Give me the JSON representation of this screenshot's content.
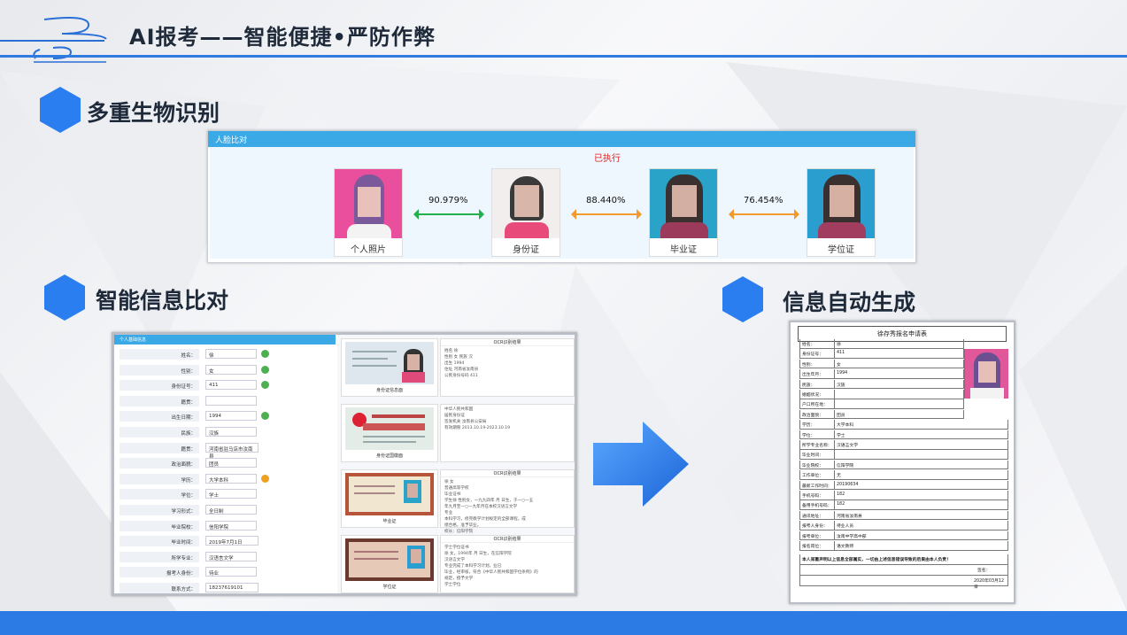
{
  "header": {
    "title": "AI报考——智能便捷•严防作弊"
  },
  "sections": {
    "bio": "多重生物识别",
    "info": "智能信息比对",
    "auto": "信息自动生成"
  },
  "face_compare": {
    "title": "人脸比对",
    "status": "已执行",
    "photos": [
      {
        "label": "个人照片"
      },
      {
        "label": "身份证"
      },
      {
        "label": "毕业证"
      },
      {
        "label": "学位证"
      }
    ],
    "scores": [
      "90.979%",
      "88.440%",
      "76.454%"
    ]
  },
  "info_compare": {
    "panel_title": "个人基础信息",
    "fields": [
      {
        "label": "姓名：",
        "value": "徐",
        "mark": "ok"
      },
      {
        "label": "性别：",
        "value": "女",
        "mark": "ok"
      },
      {
        "label": "身份证号：",
        "value": "411",
        "mark": "ok"
      },
      {
        "label": "籍贯：",
        "value": "",
        "mark": ""
      },
      {
        "label": "出生日期：",
        "value": "1994",
        "mark": "ok"
      },
      {
        "label": "民族：",
        "value": "汉族",
        "mark": ""
      },
      {
        "label": "籍贯：",
        "value": "河南省驻马店市汝南县",
        "mark": ""
      },
      {
        "label": "政治面貌：",
        "value": "团员",
        "mark": ""
      },
      {
        "label": "学历：",
        "value": "大学本科",
        "mark": "warn"
      },
      {
        "label": "学位：",
        "value": "学士",
        "mark": ""
      },
      {
        "label": "学习形式：",
        "value": "全日制",
        "mark": ""
      },
      {
        "label": "毕业院校：",
        "value": "信阳学院",
        "mark": ""
      },
      {
        "label": "毕业时间：",
        "value": "2019年7月1日",
        "mark": ""
      },
      {
        "label": "所学专业：",
        "value": "汉语言文学",
        "mark": ""
      },
      {
        "label": "报考人身份：",
        "value": "待业",
        "mark": ""
      },
      {
        "label": "联系方式：",
        "value": "18237619101",
        "mark": ""
      }
    ],
    "ocr_header": "OCR识别结果",
    "docs": [
      {
        "caption": "身份证信息面",
        "ocr": "姓名 徐\n性别 女 民族 汉\n出生 1994\n住址 河南省汝南县\n公民身份号码 411"
      },
      {
        "caption": "身份证国徽面",
        "ocr": "中华人民共和国\n居民身份证\n签发机关 汝南县公安局\n有效期限 2013.10.19-2023.10.19"
      },
      {
        "caption": "毕业证",
        "ocr": "徐 女\n普通高等学校\n毕业证书\n学生徐 性别女，一九九四年 月 日生，于一○一五\n年九月至一○一九年月在本校汉语言文学\n专业\n本科学习，修完教学计划规定的全部课程，成\n绩合格，准予毕业。\n校长：信阳学院"
      },
      {
        "caption": "学位证",
        "ocr": "学士学位证书\n徐 女，1994年 月 日生，在信阳学院\n汉语言文学\n专业完成了本科学习计划，业已\n毕业，经审核，符合《中华人民共和国学位条例》的\n规定，授予文学\n学士学位"
      }
    ]
  },
  "auto_form": {
    "title": "徐存秀报名申请表",
    "rows": [
      {
        "k": "姓名：",
        "v": "徐"
      },
      {
        "k": "身份证号：",
        "v": "411"
      },
      {
        "k": "性别：",
        "v": "女"
      },
      {
        "k": "出生年月：",
        "v": "1994"
      },
      {
        "k": "民族：",
        "v": "汉族"
      },
      {
        "k": "婚姻状况：",
        "v": ""
      },
      {
        "k": "户口所在地：",
        "v": ""
      },
      {
        "k": "政治面貌：",
        "v": "团员"
      },
      {
        "k": "学历：",
        "v": "大学本科"
      },
      {
        "k": "学位：",
        "v": "学士"
      },
      {
        "k": "所学专业名称：",
        "v": "汉语言文学"
      },
      {
        "k": "毕业时间：",
        "v": ""
      },
      {
        "k": "毕业院校：",
        "v": "信阳学院"
      },
      {
        "k": "工作单位：",
        "v": "无"
      },
      {
        "k": "最新工作时间：",
        "v": "20190634"
      },
      {
        "k": "手机号码：",
        "v": "182"
      },
      {
        "k": "备用手机号码：",
        "v": "182"
      },
      {
        "k": "通讯地址：",
        "v": "河南省汝南县"
      },
      {
        "k": "报考人身份：",
        "v": "待业人员"
      },
      {
        "k": "报考单位：",
        "v": "汝南中学高中部"
      },
      {
        "k": "报名岗位：",
        "v": "语文教师"
      }
    ],
    "pledge": "本人郑重声明以上信息全部属实，一切由上述信息错误导致的后果由本人负责！",
    "sign": "签名：",
    "date": "2020年03月12日"
  }
}
